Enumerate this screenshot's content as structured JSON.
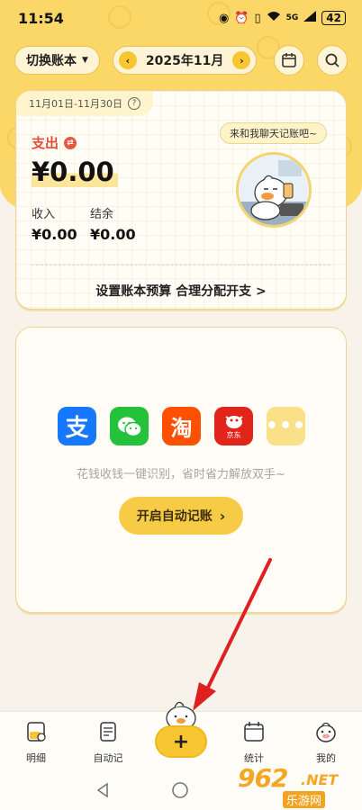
{
  "status": {
    "time": "11:54",
    "battery": "42",
    "network": "5G"
  },
  "header": {
    "switch_label": "切换账本",
    "month_label": "2025年11月"
  },
  "summary": {
    "date_range": "11月01日-11月30日",
    "expense_label": "支出",
    "expense_amount": "¥0.00",
    "income_label": "收入",
    "income_amount": "¥0.00",
    "balance_label": "结余",
    "balance_amount": "¥0.00",
    "chat_bubble": "来和我聊天记账吧~",
    "budget_link": "设置账本预算 合理分配开支 >"
  },
  "auto": {
    "apps": [
      "alipay-icon",
      "wechat-icon",
      "taobao-icon",
      "jd-icon",
      "more-icon"
    ],
    "jd_label": "京东",
    "taobao_glyph": "淘",
    "alipay_glyph": "支",
    "description": "花钱收钱一键识别，省时省力解放双手~",
    "button_label": "开启自动记账"
  },
  "tabs": {
    "detail": "明细",
    "auto": "自动记",
    "stats": "统计",
    "mine": "我的",
    "add": "+"
  },
  "watermark": {
    "number": "962",
    "suffix": ".NET",
    "sub": "乐游网"
  },
  "colors": {
    "brand_yellow": "#fad766",
    "expense_red": "#e24d3a",
    "arrow_red": "#e02020"
  }
}
